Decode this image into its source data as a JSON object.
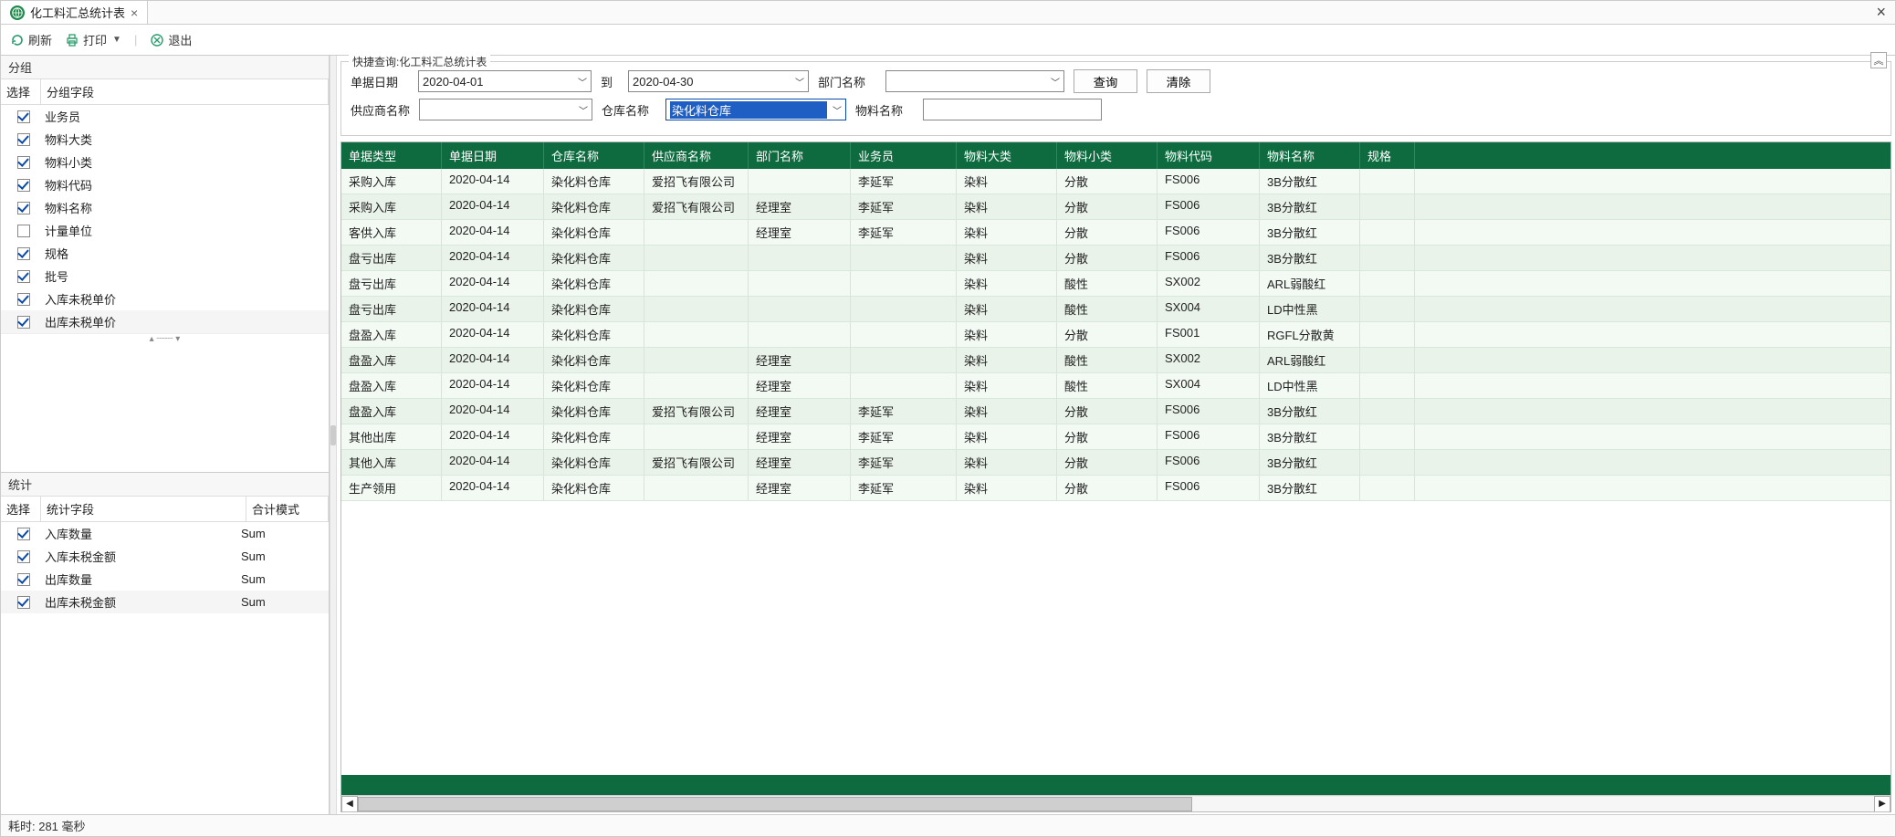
{
  "tab": {
    "title": "化工料汇总统计表"
  },
  "toolbar": {
    "refresh": "刷新",
    "print": "打印",
    "exit": "退出"
  },
  "leftPanel": {
    "group_title": "分组",
    "group_headers": {
      "select": "选择",
      "field": "分组字段"
    },
    "group_fields": [
      {
        "label": "业务员",
        "checked": true
      },
      {
        "label": "物料大类",
        "checked": true
      },
      {
        "label": "物料小类",
        "checked": true
      },
      {
        "label": "物料代码",
        "checked": true
      },
      {
        "label": "物料名称",
        "checked": true
      },
      {
        "label": "计量单位",
        "checked": false
      },
      {
        "label": "规格",
        "checked": true
      },
      {
        "label": "批号",
        "checked": true
      },
      {
        "label": "入库未税单价",
        "checked": true
      },
      {
        "label": "出库未税单价",
        "checked": true,
        "sel": true
      }
    ],
    "stat_title": "统计",
    "stat_headers": {
      "select": "选择",
      "field": "统计字段",
      "mode": "合计模式"
    },
    "stat_fields": [
      {
        "label": "入库数量",
        "mode": "Sum",
        "checked": true
      },
      {
        "label": "入库未税金额",
        "mode": "Sum",
        "checked": true
      },
      {
        "label": "出库数量",
        "mode": "Sum",
        "checked": true
      },
      {
        "label": "出库未税金额",
        "mode": "Sum",
        "checked": true,
        "sel": true
      }
    ]
  },
  "query": {
    "legend": "快捷查询:化工料汇总统计表",
    "labels": {
      "doc_date": "单据日期",
      "to": "到",
      "dept": "部门名称",
      "supplier": "供应商名称",
      "warehouse": "仓库名称",
      "material": "物料名称",
      "search": "查询",
      "clear": "清除"
    },
    "values": {
      "date_from": "2020-04-01",
      "date_to": "2020-04-30",
      "dept": "",
      "supplier": "",
      "warehouse": "染化料仓库",
      "material": ""
    }
  },
  "table": {
    "columns": [
      "单据类型",
      "单据日期",
      "仓库名称",
      "供应商名称",
      "部门名称",
      "业务员",
      "物料大类",
      "物料小类",
      "物料代码",
      "物料名称",
      "规格"
    ],
    "rows": [
      [
        "采购入库",
        "2020-04-14",
        "染化料仓库",
        "爱招飞有限公司",
        "",
        "李延军",
        "染料",
        "分散",
        "FS006",
        "3B分散红",
        ""
      ],
      [
        "采购入库",
        "2020-04-14",
        "染化料仓库",
        "爱招飞有限公司",
        "经理室",
        "李延军",
        "染料",
        "分散",
        "FS006",
        "3B分散红",
        ""
      ],
      [
        "客供入库",
        "2020-04-14",
        "染化料仓库",
        "",
        "经理室",
        "李延军",
        "染料",
        "分散",
        "FS006",
        "3B分散红",
        ""
      ],
      [
        "盘亏出库",
        "2020-04-14",
        "染化料仓库",
        "",
        "",
        "",
        "染料",
        "分散",
        "FS006",
        "3B分散红",
        ""
      ],
      [
        "盘亏出库",
        "2020-04-14",
        "染化料仓库",
        "",
        "",
        "",
        "染料",
        "酸性",
        "SX002",
        "ARL弱酸红",
        ""
      ],
      [
        "盘亏出库",
        "2020-04-14",
        "染化料仓库",
        "",
        "",
        "",
        "染料",
        "酸性",
        "SX004",
        "LD中性黑",
        ""
      ],
      [
        "盘盈入库",
        "2020-04-14",
        "染化料仓库",
        "",
        "",
        "",
        "染料",
        "分散",
        "FS001",
        "RGFL分散黄",
        ""
      ],
      [
        "盘盈入库",
        "2020-04-14",
        "染化料仓库",
        "",
        "经理室",
        "",
        "染料",
        "酸性",
        "SX002",
        "ARL弱酸红",
        ""
      ],
      [
        "盘盈入库",
        "2020-04-14",
        "染化料仓库",
        "",
        "经理室",
        "",
        "染料",
        "酸性",
        "SX004",
        "LD中性黑",
        ""
      ],
      [
        "盘盈入库",
        "2020-04-14",
        "染化料仓库",
        "爱招飞有限公司",
        "经理室",
        "李延军",
        "染料",
        "分散",
        "FS006",
        "3B分散红",
        ""
      ],
      [
        "其他出库",
        "2020-04-14",
        "染化料仓库",
        "",
        "经理室",
        "李延军",
        "染料",
        "分散",
        "FS006",
        "3B分散红",
        ""
      ],
      [
        "其他入库",
        "2020-04-14",
        "染化料仓库",
        "爱招飞有限公司",
        "经理室",
        "李延军",
        "染料",
        "分散",
        "FS006",
        "3B分散红",
        ""
      ],
      [
        "生产领用",
        "2020-04-14",
        "染化料仓库",
        "",
        "经理室",
        "李延军",
        "染料",
        "分散",
        "FS006",
        "3B分散红",
        ""
      ]
    ]
  },
  "status": {
    "text": "耗时: 281 毫秒"
  }
}
